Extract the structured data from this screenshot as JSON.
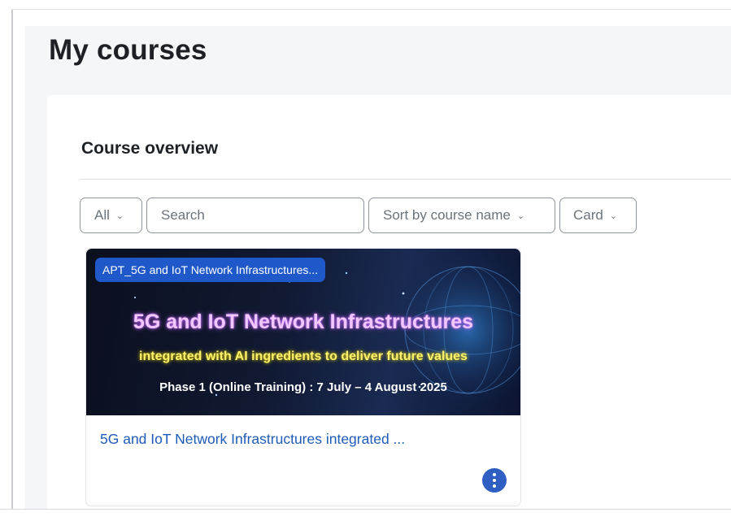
{
  "page": {
    "title": "My courses"
  },
  "course_overview": {
    "title": "Course overview",
    "filters": {
      "grouping": "All",
      "search_placeholder": "Search",
      "sort": "Sort by course name",
      "view": "Card"
    },
    "courses": [
      {
        "category": "APT_5G and IoT Network Infrastructures...",
        "banner": {
          "headline": "5G and IoT Network Infrastructures",
          "subheadline": "integrated with AI ingredients to deliver future values",
          "dates": "Phase 1 (Online Training) : 7 July – 4 August 2025"
        },
        "name": "5G and IoT Network Infrastructures integrated ..."
      }
    ]
  },
  "icons": {
    "dropdown": "chevron-down-icon",
    "more": "vertical-dots-icon"
  },
  "colors": {
    "accent": "#1f58c9",
    "link": "#1f5bb8",
    "page_bg": "#f5f6f8"
  }
}
